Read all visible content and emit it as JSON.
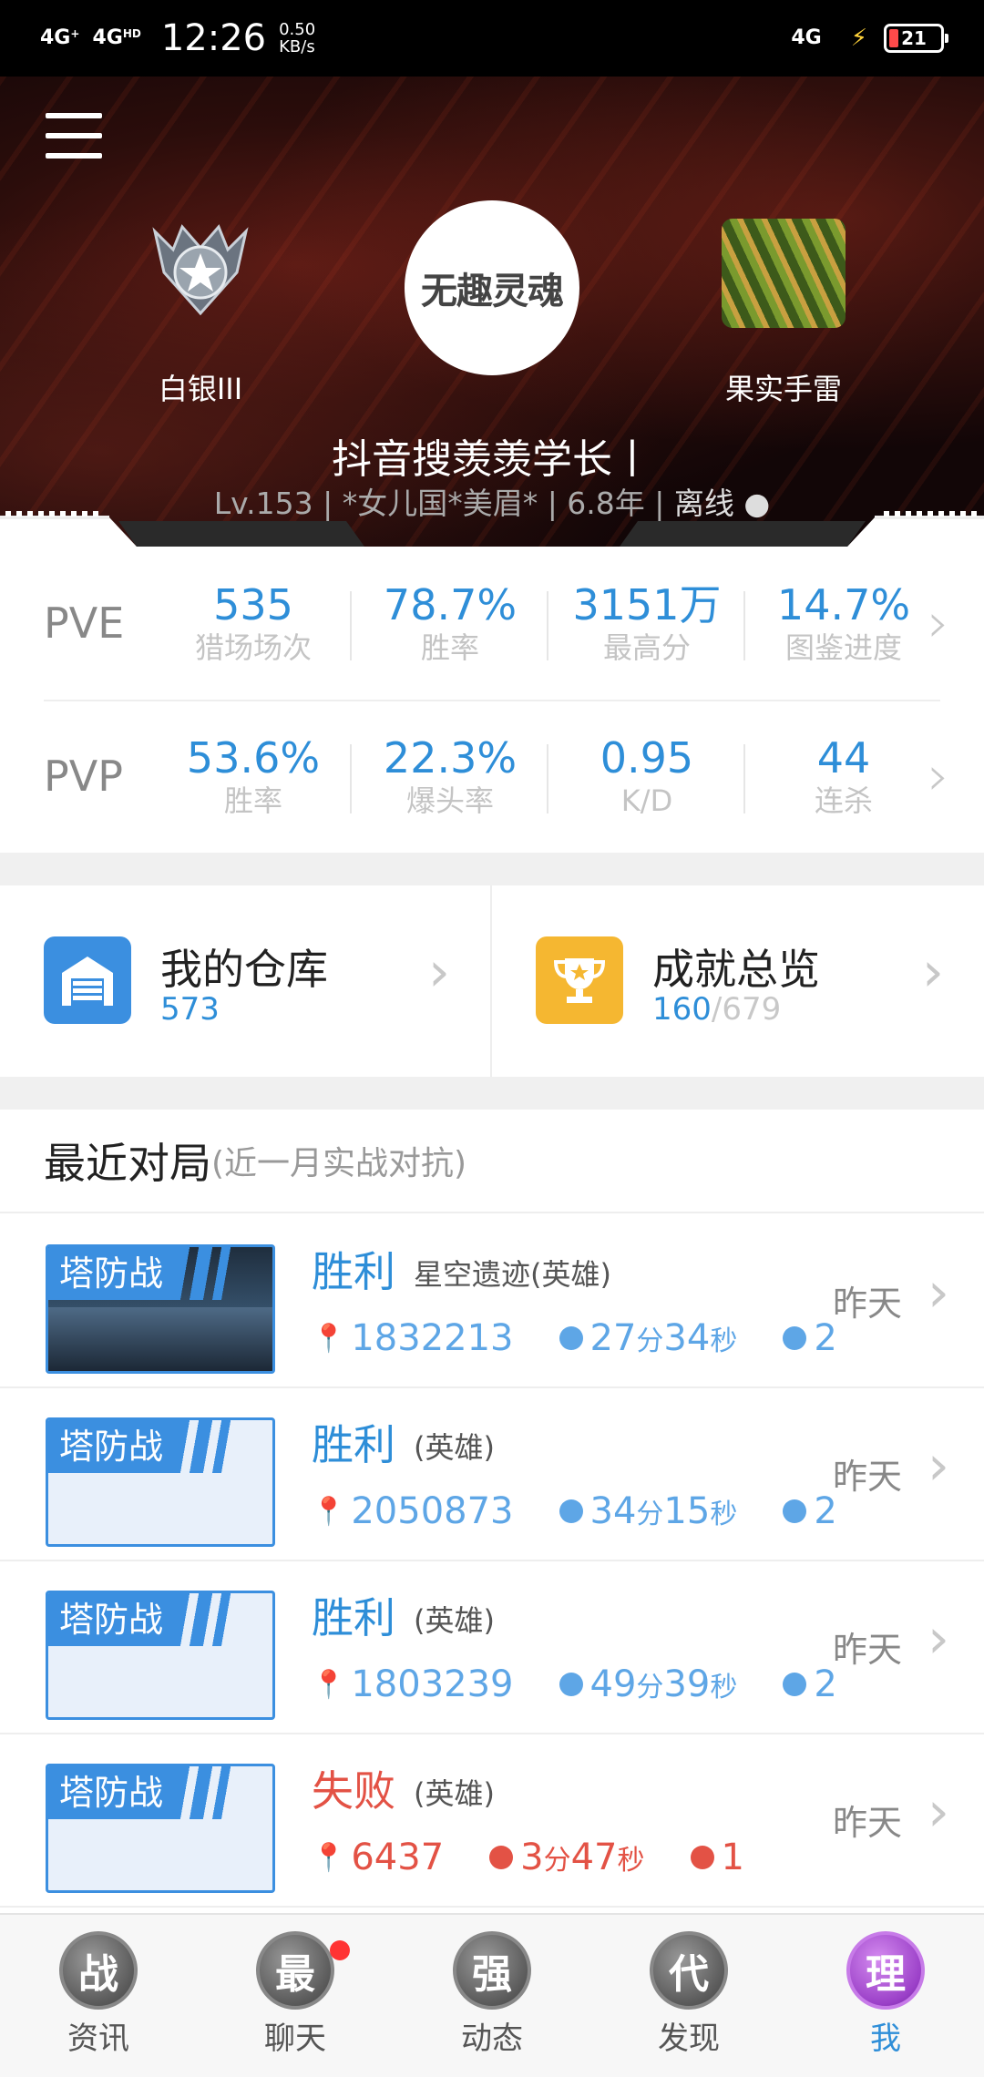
{
  "status_bar": {
    "sig1": "4G",
    "sig2": "4G",
    "time": "12:26",
    "speed_val": "0.50",
    "speed_unit": "KB/s",
    "net_right": "4G",
    "battery": "21"
  },
  "profile": {
    "avatar_text": "无趣灵魂",
    "rank_label": "白银III",
    "weapon_label": "果实手雷",
    "name": "抖音搜羡羡学长丨",
    "info": "Lv.153 | *女儿国*美眉* | 6.8年 |",
    "status": "离线 ●"
  },
  "pve": {
    "label": "PVE",
    "stats": [
      {
        "value": "535",
        "key": "猎场场次"
      },
      {
        "value": "78.7%",
        "key": "胜率"
      },
      {
        "value": "3151万",
        "key": "最高分"
      },
      {
        "value": "14.7%",
        "key": "图鉴进度"
      }
    ]
  },
  "pvp": {
    "label": "PVP",
    "stats": [
      {
        "value": "53.6%",
        "key": "胜率"
      },
      {
        "value": "22.3%",
        "key": "爆头率"
      },
      {
        "value": "0.95",
        "key": "K/D"
      },
      {
        "value": "44",
        "key": "连杀"
      }
    ]
  },
  "cards": {
    "warehouse": {
      "title": "我的仓库",
      "count": "573"
    },
    "achievement": {
      "title": "成就总览",
      "done": "160",
      "total": "/679"
    }
  },
  "recent": {
    "title": "最近对局",
    "subtitle": "(近一月实战对抗)",
    "matches": [
      {
        "tag": "塔防战",
        "result": "胜利",
        "mode": "星空遗迹(英雄)",
        "score": "1832213",
        "dur_m": "27",
        "dur_s": "34",
        "deaths": "2",
        "when": "昨天"
      },
      {
        "tag": "塔防战",
        "result": "胜利",
        "mode": "(英雄)",
        "score": "2050873",
        "dur_m": "34",
        "dur_s": "15",
        "deaths": "2",
        "when": "昨天"
      },
      {
        "tag": "塔防战",
        "result": "胜利",
        "mode": "(英雄)",
        "score": "1803239",
        "dur_m": "49",
        "dur_s": "39",
        "deaths": "2",
        "when": "昨天"
      },
      {
        "tag": "塔防战",
        "result": "失败",
        "mode": "(英雄)",
        "score": "6437",
        "dur_m": "3",
        "dur_s": "47",
        "deaths": "1",
        "when": "昨天"
      }
    ],
    "unit_min": "分",
    "unit_sec": "秒"
  },
  "tabs": [
    {
      "icon": "战",
      "label": "资讯"
    },
    {
      "icon": "最",
      "label": "聊天"
    },
    {
      "icon": "强",
      "label": "动态"
    },
    {
      "icon": "代",
      "label": "发现"
    },
    {
      "icon": "理",
      "label": "我"
    }
  ],
  "colors": {
    "accent": "#2e8ed8",
    "lose": "#e35245",
    "badge": "#ff3333"
  }
}
